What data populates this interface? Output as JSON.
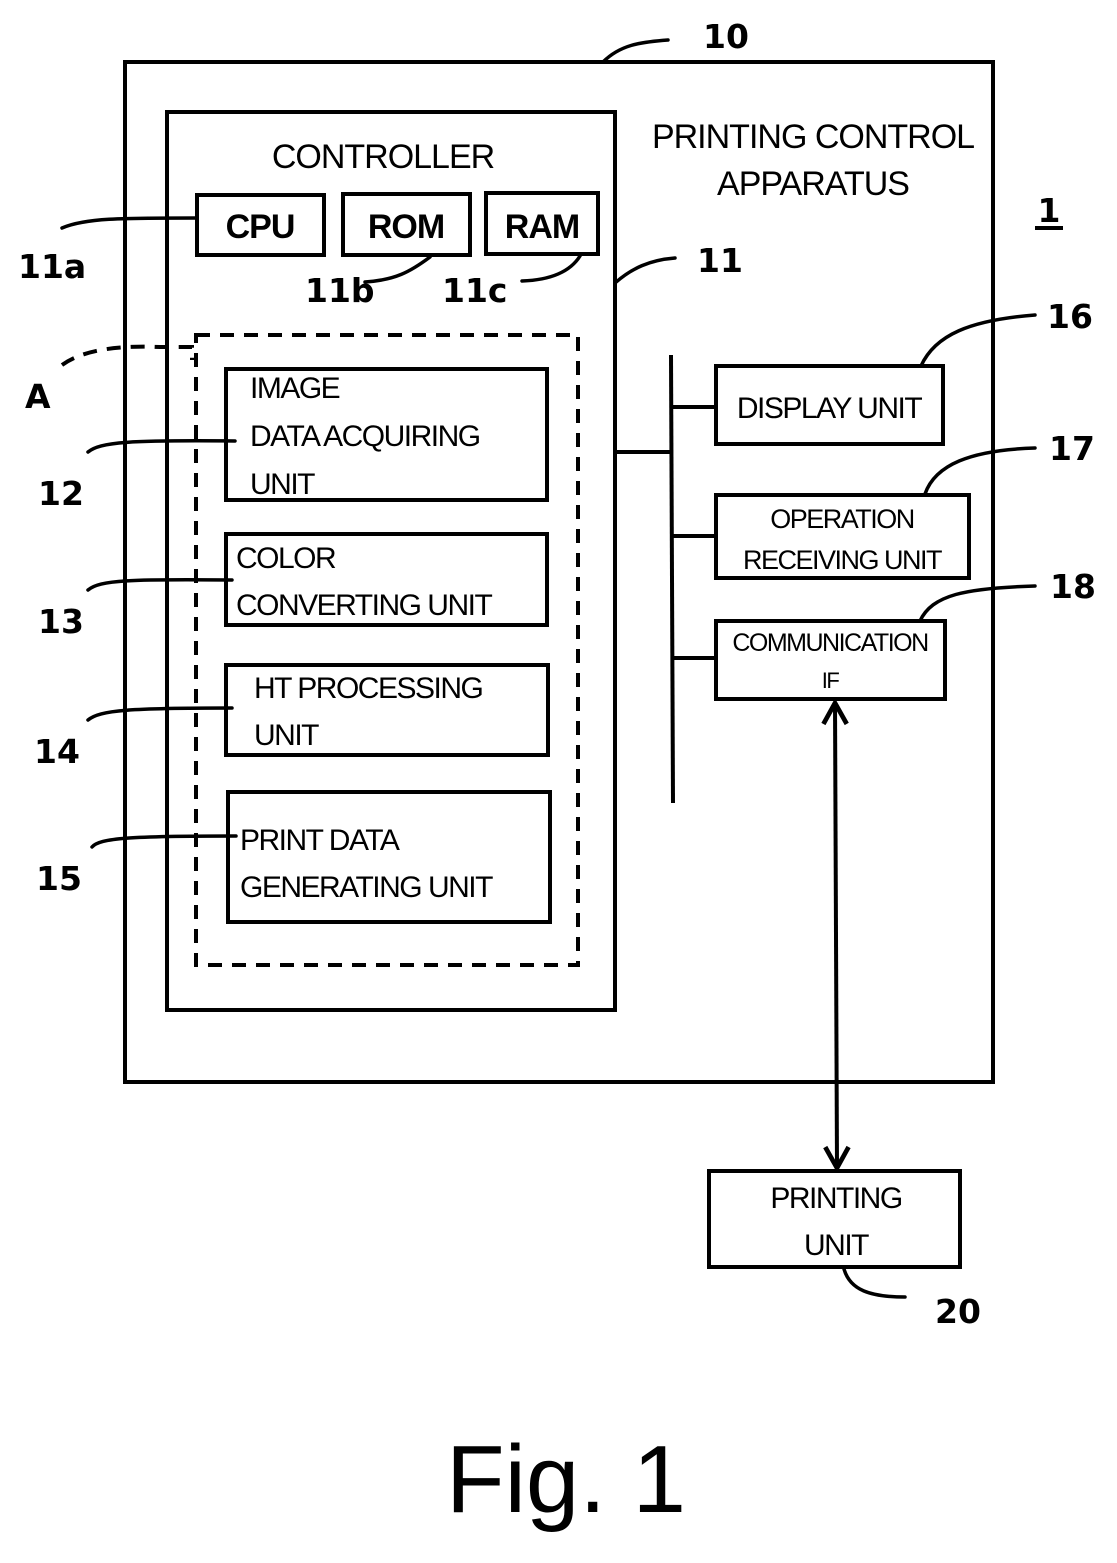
{
  "figure": {
    "caption": "Fig. 1",
    "system_ref": "1"
  },
  "apparatus": {
    "title_line1": "PRINTING CONTROL",
    "title_line2": "APPARATUS",
    "ref": "10"
  },
  "controller": {
    "title": "CONTROLLER",
    "ref": "11",
    "cpu": {
      "label": "CPU",
      "ref": "11a"
    },
    "rom": {
      "label": "ROM",
      "ref": "11b"
    },
    "ram": {
      "label": "RAM",
      "ref": "11c"
    }
  },
  "group_a": {
    "ref": "A"
  },
  "units": {
    "image_data_acquiring": {
      "line1": "IMAGE",
      "line2": "DATA ACQUIRING",
      "line3": "UNIT",
      "ref": "12"
    },
    "color_converting": {
      "line1": "COLOR",
      "line2": "CONVERTING UNIT",
      "ref": "13"
    },
    "ht_processing": {
      "line1": "HT PROCESSING",
      "line2": "UNIT",
      "ref": "14"
    },
    "print_data_generating": {
      "line1": "PRINT DATA",
      "line2": "GENERATING UNIT",
      "ref": "15"
    },
    "display": {
      "label": "DISPLAY UNIT",
      "ref": "16"
    },
    "operation_receiving": {
      "line1": "OPERATION",
      "line2": "RECEIVING UNIT",
      "ref": "17"
    },
    "communication_if": {
      "line1": "COMMUNICATION",
      "line2": "IF",
      "ref": "18"
    }
  },
  "printing_unit": {
    "line1": "PRINTING",
    "line2": "UNIT",
    "ref": "20"
  }
}
